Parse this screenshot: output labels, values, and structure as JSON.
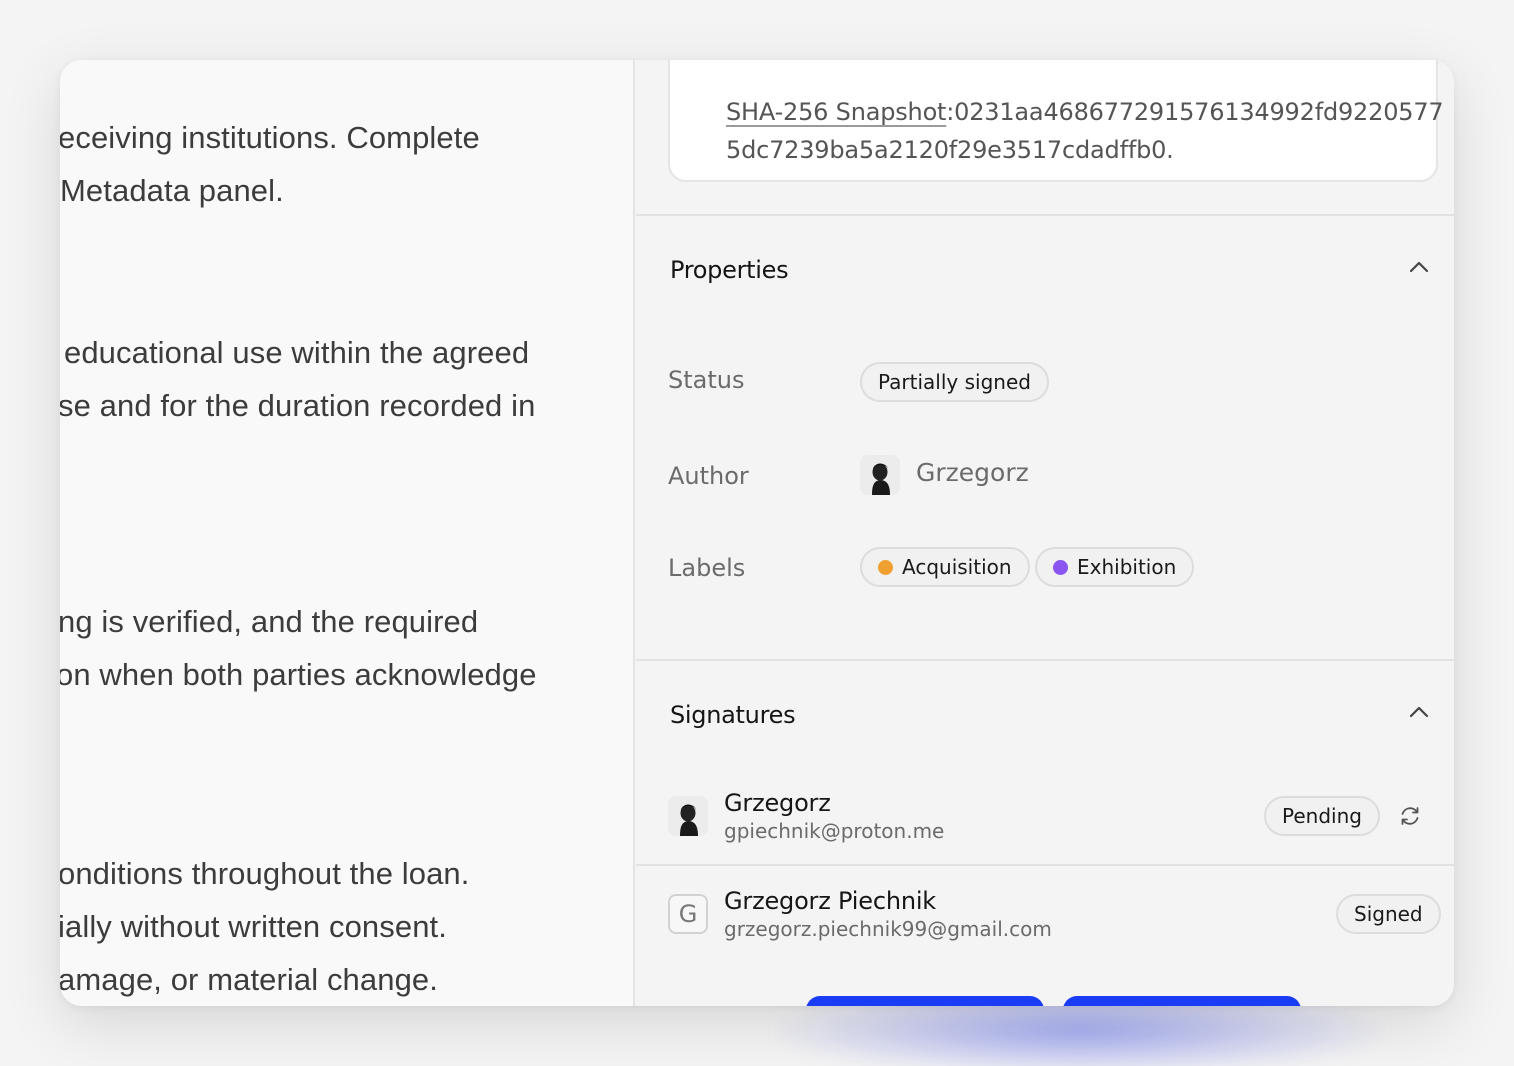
{
  "document": {
    "lines": [
      "eceiving institutions. Complete",
      "Metadata panel.",
      "educational use within the agreed",
      "se and for the duration recorded in",
      "ng is verified, and the required",
      "on when both parties acknowledge",
      "onditions throughout the loan.",
      "ially without written consent.",
      "amage, or material change."
    ]
  },
  "hash": {
    "label": "SHA-256 Snapshot",
    "value_line1": ": 0231aa4686772915761349 92fd9220577",
    "value_line2": "5dc7239ba5a2120f29e3517cdadffb0."
  },
  "properties": {
    "title": "Properties",
    "status_label": "Status",
    "status_value": "Partially signed",
    "author_label": "Author",
    "author_name": "Grzegorz",
    "labels_label": "Labels",
    "labels": [
      {
        "name": "Acquisition",
        "color": "#f0a030"
      },
      {
        "name": "Exhibition",
        "color": "#8a55f0"
      }
    ]
  },
  "signatures": {
    "title": "Signatures",
    "items": [
      {
        "name": "Grzegorz",
        "email": "gpiechnik@proton.me",
        "status": "Pending"
      },
      {
        "name": "Grzegorz Piechnik",
        "email": "grzegorz.piechnik99@gmail.com",
        "status": "Signed",
        "initial": "G"
      }
    ]
  },
  "colors": {
    "accent": "#1a3cf5"
  }
}
